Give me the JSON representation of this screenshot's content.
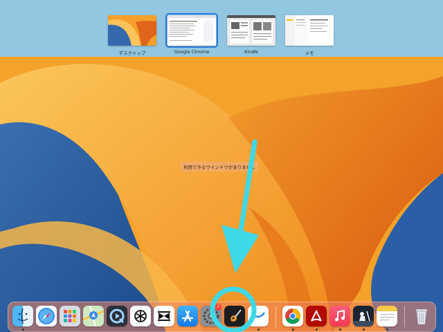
{
  "mission_control": {
    "spaces": [
      {
        "label": "デスクトップ",
        "selected": false
      },
      {
        "label": "Google Chrome",
        "selected": true
      },
      {
        "label": "Kindle",
        "selected": false
      },
      {
        "label": "メモ",
        "selected": false
      }
    ],
    "no_windows_text": "利用できるウインドウがありません"
  },
  "dock": {
    "apps": [
      {
        "icon": "finder-icon",
        "running": true
      },
      {
        "icon": "safari-icon",
        "running": false
      },
      {
        "icon": "launchpad-icon",
        "running": false
      },
      {
        "icon": "maps-icon",
        "running": false
      },
      {
        "icon": "quicktime-icon",
        "running": false
      },
      {
        "icon": "chatgpt-icon",
        "running": false
      },
      {
        "icon": "capcut-icon",
        "running": false
      },
      {
        "icon": "app-store-icon",
        "running": false
      },
      {
        "icon": "system-settings-icon",
        "running": false,
        "badge": "2"
      },
      {
        "icon": "garageband-icon",
        "running": true
      },
      {
        "icon": "freeform-icon",
        "running": true
      },
      {
        "icon": "chrome-icon",
        "running": true
      },
      {
        "icon": "acrobat-icon",
        "running": true
      },
      {
        "icon": "music-icon",
        "running": true
      },
      {
        "icon": "kindle-icon",
        "running": true
      },
      {
        "icon": "notes-icon",
        "running": true
      },
      {
        "icon": "trash-icon",
        "running": false
      }
    ]
  },
  "colors": {
    "annotation": "#3fd8e6",
    "spaces_bar": "#8cc8eb",
    "selected_outline": "#2a7ad8"
  }
}
